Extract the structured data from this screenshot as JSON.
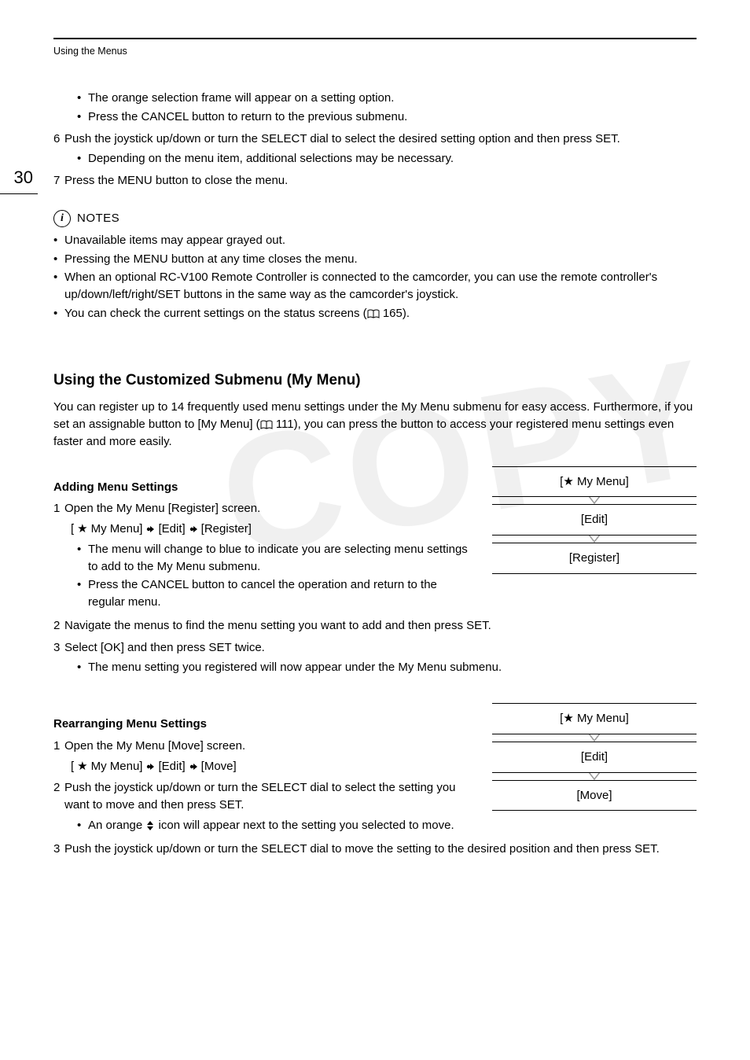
{
  "header": {
    "title": "Using the Menus"
  },
  "page_number": "30",
  "top_bullets": [
    "The orange selection frame will appear on a setting option.",
    "Press the CANCEL button to return to the previous submenu."
  ],
  "step6": {
    "num": "6",
    "text": "Push the joystick up/down or turn the SELECT dial to select the desired setting option and then press SET.",
    "sub": [
      "Depending on the menu item, additional selections may be necessary."
    ]
  },
  "step7": {
    "num": "7",
    "text": "Press the MENU button to close the menu."
  },
  "notes": {
    "heading": "NOTES",
    "items": [
      {
        "text": "Unavailable items may appear grayed out."
      },
      {
        "text": "Pressing the MENU button at any time closes the menu."
      },
      {
        "text": "When an optional RC-V100 Remote Controller is connected to the camcorder, you can use the remote controller's up/down/left/right/SET buttons in the same way as the camcorder's joystick."
      },
      {
        "text_pre": "You can check the current settings on the status screens (",
        "page_ref": " 165).",
        "has_book": true
      }
    ]
  },
  "section": {
    "title": "Using the Customized Submenu (My Menu)",
    "body_pre": "You can register up to 14 frequently used menu settings under the My Menu submenu for easy access. Furthermore, if you set an assignable button to [My Menu] (",
    "body_ref": " 111), you can press the button to access your registered menu settings even faster and more easily."
  },
  "adding": {
    "heading": "Adding Menu Settings",
    "steps": {
      "s1": {
        "num": "1",
        "text": "Open the My Menu [Register] screen."
      },
      "path": {
        "a": " My Menu]",
        "b": "[Edit]",
        "c": "[Register]"
      },
      "s1_bullets": [
        "The menu will change to blue to indicate you are selecting menu settings to add to the My Menu submenu.",
        "Press the CANCEL button to cancel the operation and return to the regular menu."
      ],
      "s2": {
        "num": "2",
        "text": "Navigate the menus to find the menu setting you want to add and then press SET."
      },
      "s3": {
        "num": "3",
        "text": "Select [OK] and then press SET twice."
      },
      "s3_bullets": [
        "The menu setting you registered will now appear under the My Menu submenu."
      ]
    },
    "menu": {
      "l1": " My Menu]",
      "l2": "[Edit]",
      "l3": "[Register]"
    }
  },
  "rearranging": {
    "heading": "Rearranging Menu Settings",
    "steps": {
      "s1": {
        "num": "1",
        "text": "Open the My Menu [Move] screen."
      },
      "path": {
        "a": " My Menu]",
        "b": "[Edit]",
        "c": "[Move]"
      },
      "s2": {
        "num": "2",
        "text": "Push the joystick up/down or turn the SELECT dial to select the setting you want to move and then press SET."
      },
      "s2_bullet_pre": "An orange ",
      "s2_bullet_post": " icon will appear next to the setting you selected to move.",
      "s3": {
        "num": "3",
        "text": "Push the joystick up/down or turn the SELECT dial to move the setting to the desired position and then press SET."
      }
    },
    "menu": {
      "l1": " My Menu]",
      "l2": "[Edit]",
      "l3": "[Move]"
    }
  }
}
